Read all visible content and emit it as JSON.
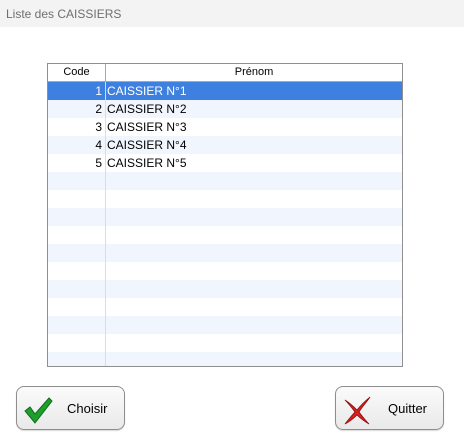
{
  "window": {
    "title": "Liste des CAISSIERS"
  },
  "grid": {
    "columns": {
      "code": "Code",
      "prenom": "Prénom"
    },
    "rows": [
      {
        "code": "1",
        "prenom": "CAISSIER N°1",
        "selected": true
      },
      {
        "code": "2",
        "prenom": "CAISSIER N°2",
        "selected": false
      },
      {
        "code": "3",
        "prenom": "CAISSIER N°3",
        "selected": false
      },
      {
        "code": "4",
        "prenom": "CAISSIER N°4",
        "selected": false
      },
      {
        "code": "5",
        "prenom": "CAISSIER N°5",
        "selected": false
      }
    ],
    "selection_color": "#3d80e0"
  },
  "buttons": {
    "choisir": {
      "label": "Choisir",
      "icon": "green-checkmark-icon"
    },
    "quitter": {
      "label": "Quitter",
      "icon": "red-x-icon"
    }
  }
}
